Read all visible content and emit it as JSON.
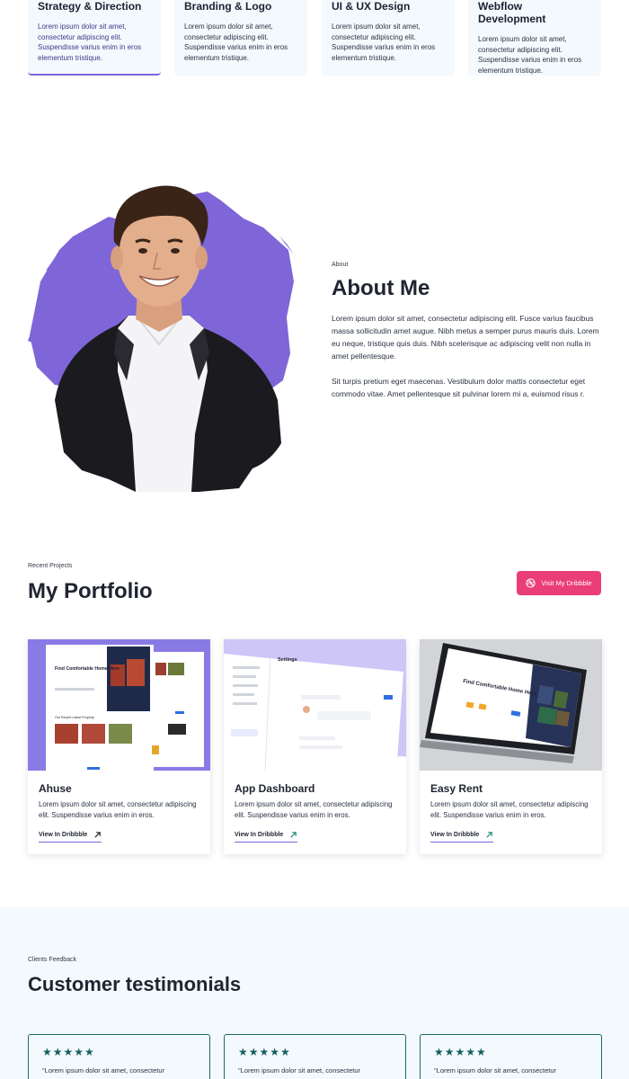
{
  "services": [
    {
      "title": "Strategy & Direction",
      "text": "Lorem ipsum dolor sit amet, consectetur adipiscing elit. Suspendisse varius enim in eros elementum tristique."
    },
    {
      "title": "Branding & Logo",
      "text": "Lorem ipsum dolor sit amet, consectetur adipiscing elit. Suspendisse varius enim in eros elementum tristique."
    },
    {
      "title": "UI & UX Design",
      "text": "Lorem ipsum dolor sit amet, consectetur adipiscing elit. Suspendisse varius enim in eros elementum tristique."
    },
    {
      "title": "Webflow Development",
      "text": "Lorem ipsum dolor sit amet, consectetur adipiscing elit. Suspendisse varius enim in eros elementum tristique."
    }
  ],
  "about": {
    "label": "About",
    "title": "About Me",
    "p1": "Lorem ipsum dolor sit amet, consectetur adipiscing elit. Fusce varius faucibus massa sollicitudin amet augue. Nibh metus a semper purus mauris duis. Lorem eu neque, tristique quis duis. Nibh scelerisque ac adipiscing velit non nulla in amet pellentesque.",
    "p2": "Sit turpis pretium eget maecenas. Vestibulum dolor mattis consectetur eget commodo vitae. Amet pellentesque sit pulvinar lorem mi a, euismod risus r."
  },
  "portfolio": {
    "label": "Recent Projects",
    "title": "My Portfolio",
    "button": "Visit My Dribbble",
    "projects": [
      {
        "title": "Ahuse",
        "desc": "Lorem ipsum dolor sit amet, consectetur adipiscing elit. Suspendisse varius enim in eros.",
        "link": "View In Dribbble",
        "thumb_text": "Find Comfortable Home Here",
        "thumb_sub": "Our Recent Latest Property"
      },
      {
        "title": "App Dashboard",
        "desc": "Lorem ipsum dolor sit amet, consectetur adipiscing elit. Suspendisse varius enim in eros.",
        "link": "View In Dribbble",
        "thumb_text": "Settings"
      },
      {
        "title": "Easy Rent",
        "desc": "Lorem ipsum dolor sit amet, consectetur adipiscing elit. Suspendisse varius enim in eros.",
        "link": "View In Dribbble",
        "thumb_text": "Find Comfortable Home Here"
      }
    ]
  },
  "testimonials": {
    "label": "Clients Feedback",
    "title": "Customer testimonials",
    "items": [
      {
        "stars": "★★★★★",
        "quote": "\"Lorem ipsum dolor sit amet, consectetur"
      },
      {
        "stars": "★★★★★",
        "quote": "\"Lorem ipsum dolor sit amet, consectetur"
      },
      {
        "stars": "★★★★★",
        "quote": "\"Lorem ipsum dolor sit amet, consectetur"
      }
    ]
  },
  "colors": {
    "accent": "#7b64e0",
    "dribbble": "#ea3e77",
    "star": "#145f5f",
    "panel_bg": "#f4f9fd"
  },
  "icons": {
    "dribbble": "dribbble-icon",
    "link_arrow": "arrow-up-right-icon",
    "star": "star-icon"
  }
}
